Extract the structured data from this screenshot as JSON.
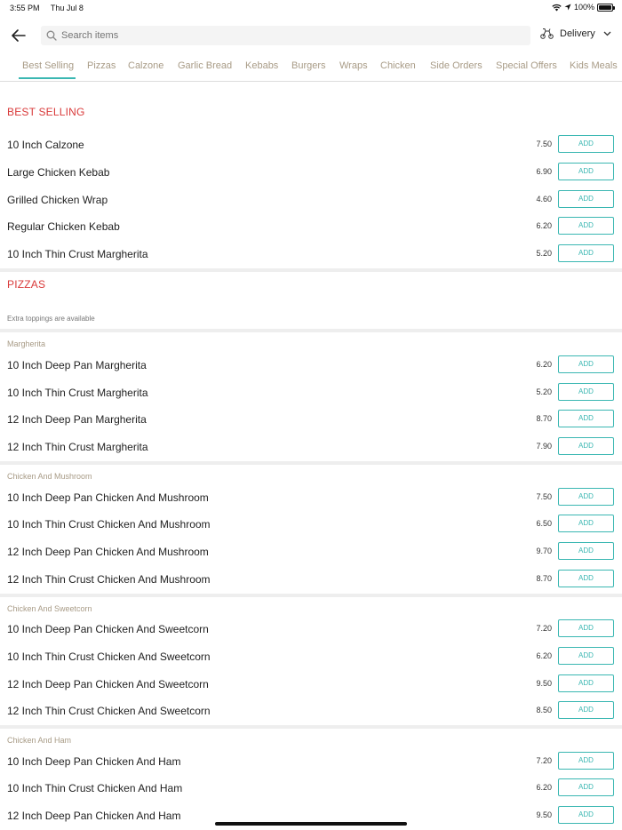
{
  "status": {
    "time": "3:55 PM",
    "date": "Thu Jul 8",
    "battery": "100%"
  },
  "search": {
    "placeholder": "Search items"
  },
  "delivery": {
    "label": "Delivery"
  },
  "tabs": [
    "Best Selling",
    "Pizzas",
    "Calzone",
    "Garlic Bread",
    "Kebabs",
    "Burgers",
    "Wraps",
    "Chicken",
    "Side Orders",
    "Special Offers",
    "Kids Meals"
  ],
  "accent_color": "#3ab7b2",
  "section_color": "#d93a3a",
  "add_label": "ADD",
  "best_selling": {
    "title": "BEST SELLING",
    "items": [
      {
        "name": "10 Inch Calzone",
        "price": "7.50"
      },
      {
        "name": "Large Chicken Kebab",
        "price": "6.90"
      },
      {
        "name": "Grilled Chicken Wrap",
        "price": "4.60"
      },
      {
        "name": "Regular Chicken Kebab",
        "price": "6.20"
      },
      {
        "name": "10 Inch Thin Crust Margherita",
        "price": "5.20"
      }
    ]
  },
  "pizzas": {
    "title": "PIZZAS",
    "note": "Extra toppings are available",
    "groups": [
      {
        "label": "Margherita",
        "items": [
          {
            "name": "10 Inch Deep Pan Margherita",
            "price": "6.20"
          },
          {
            "name": "10 Inch Thin Crust Margherita",
            "price": "5.20"
          },
          {
            "name": "12 Inch Deep Pan Margherita",
            "price": "8.70"
          },
          {
            "name": "12 Inch Thin Crust Margherita",
            "price": "7.90"
          }
        ]
      },
      {
        "label": "Chicken And Mushroom",
        "items": [
          {
            "name": "10 Inch Deep Pan Chicken And Mushroom",
            "price": "7.50"
          },
          {
            "name": "10 Inch Thin Crust Chicken And Mushroom",
            "price": "6.50"
          },
          {
            "name": "12 Inch Deep Pan Chicken And Mushroom",
            "price": "9.70"
          },
          {
            "name": "12 Inch Thin Crust Chicken And Mushroom",
            "price": "8.70"
          }
        ]
      },
      {
        "label": "Chicken And Sweetcorn",
        "items": [
          {
            "name": "10 Inch Deep Pan Chicken And Sweetcorn",
            "price": "7.20"
          },
          {
            "name": "10 Inch Thin Crust Chicken And Sweetcorn",
            "price": "6.20"
          },
          {
            "name": "12 Inch Deep Pan Chicken And Sweetcorn",
            "price": "9.50"
          },
          {
            "name": "12 Inch Thin Crust Chicken And Sweetcorn",
            "price": "8.50"
          }
        ]
      },
      {
        "label": "Chicken And Ham",
        "items": [
          {
            "name": "10 Inch Deep Pan Chicken And Ham",
            "price": "7.20"
          },
          {
            "name": "10 Inch Thin Crust Chicken And Ham",
            "price": "6.20"
          },
          {
            "name": "12 Inch Deep Pan Chicken And Ham",
            "price": "9.50"
          }
        ]
      }
    ]
  }
}
